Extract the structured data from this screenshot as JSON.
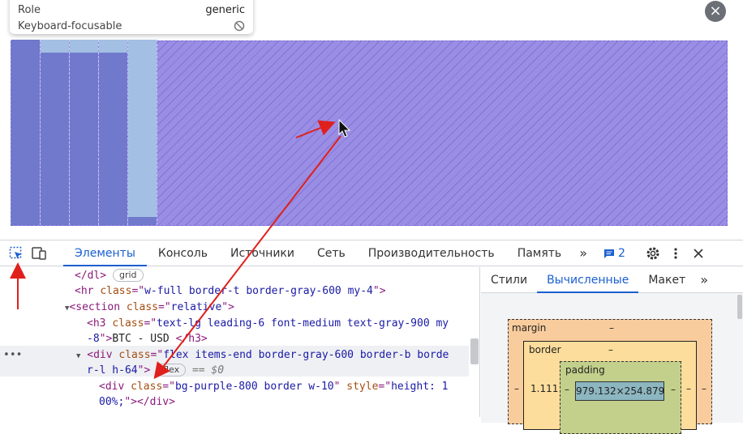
{
  "tooltip": {
    "role_label": "Role",
    "role_value": "generic",
    "keyboard_label": "Keyboard-focusable"
  },
  "chart_preview": {
    "bar_levels": [
      1.0,
      0.93,
      0.93,
      0.93,
      0.04
    ]
  },
  "devtools": {
    "tabs": [
      "Элементы",
      "Консоль",
      "Источники",
      "Сеть",
      "Производительность",
      "Память"
    ],
    "active_tab": "Элементы",
    "issues_count": "2"
  },
  "elements": {
    "lines": {
      "l1": {
        "text": "</dl>",
        "pill": "grid"
      },
      "l2": {
        "open": "<hr ",
        "attr": "class",
        "eq": "=\"",
        "val": "w-full border-t border-gray-600 my-4",
        "close": "\">"
      },
      "l3": {
        "open": "<section ",
        "attr": "class",
        "eq": "=\"",
        "val": "relative",
        "close": "\">"
      },
      "l4a": {
        "open": "<h3 ",
        "attr": "class",
        "eq": "=\"",
        "val": "text-lg leading-6 font-medium text-gray-900 my"
      },
      "l4b": {
        "val": "-8",
        "close": "\">",
        "text": "BTC - USD ",
        "end": "</h3>"
      },
      "l5a": {
        "open": "<div ",
        "attr": "class",
        "eq": "=\"",
        "val": "flex items-end border-gray-600 border-b borde"
      },
      "l5b": {
        "val": "r-l h-64",
        "close": "\">",
        "pill": "flex",
        "eqnote": "== $0"
      },
      "l6a": {
        "open": "<div ",
        "attr": "class",
        "eq": "=\"",
        "val": "bg-purple-800 border w-10",
        "attr2": " style",
        "eq2": "=\"",
        "val2": "height: 1"
      },
      "l6b": {
        "val": "00%;",
        "close": "\">",
        "end": "</div>"
      }
    }
  },
  "side": {
    "tabs": [
      "Стили",
      "Вычисленные",
      "Макет"
    ],
    "active_tab": "Вычисленные",
    "box_model": {
      "margin_label": "margin",
      "margin_value": "–",
      "border_label": "border",
      "border_value": "–",
      "padding_label": "padding",
      "left_value": "1.111",
      "padding_side": "–",
      "content": "979.132×254.879",
      "right_value": "–",
      "outer_right": "–"
    }
  },
  "colors": {
    "accent": "#1a5fd0",
    "highlight_fill": "#9a8ee4",
    "bar_fill": "#7079cc",
    "bar_top": "#a3bfe4",
    "arrow": "#e0201c"
  }
}
